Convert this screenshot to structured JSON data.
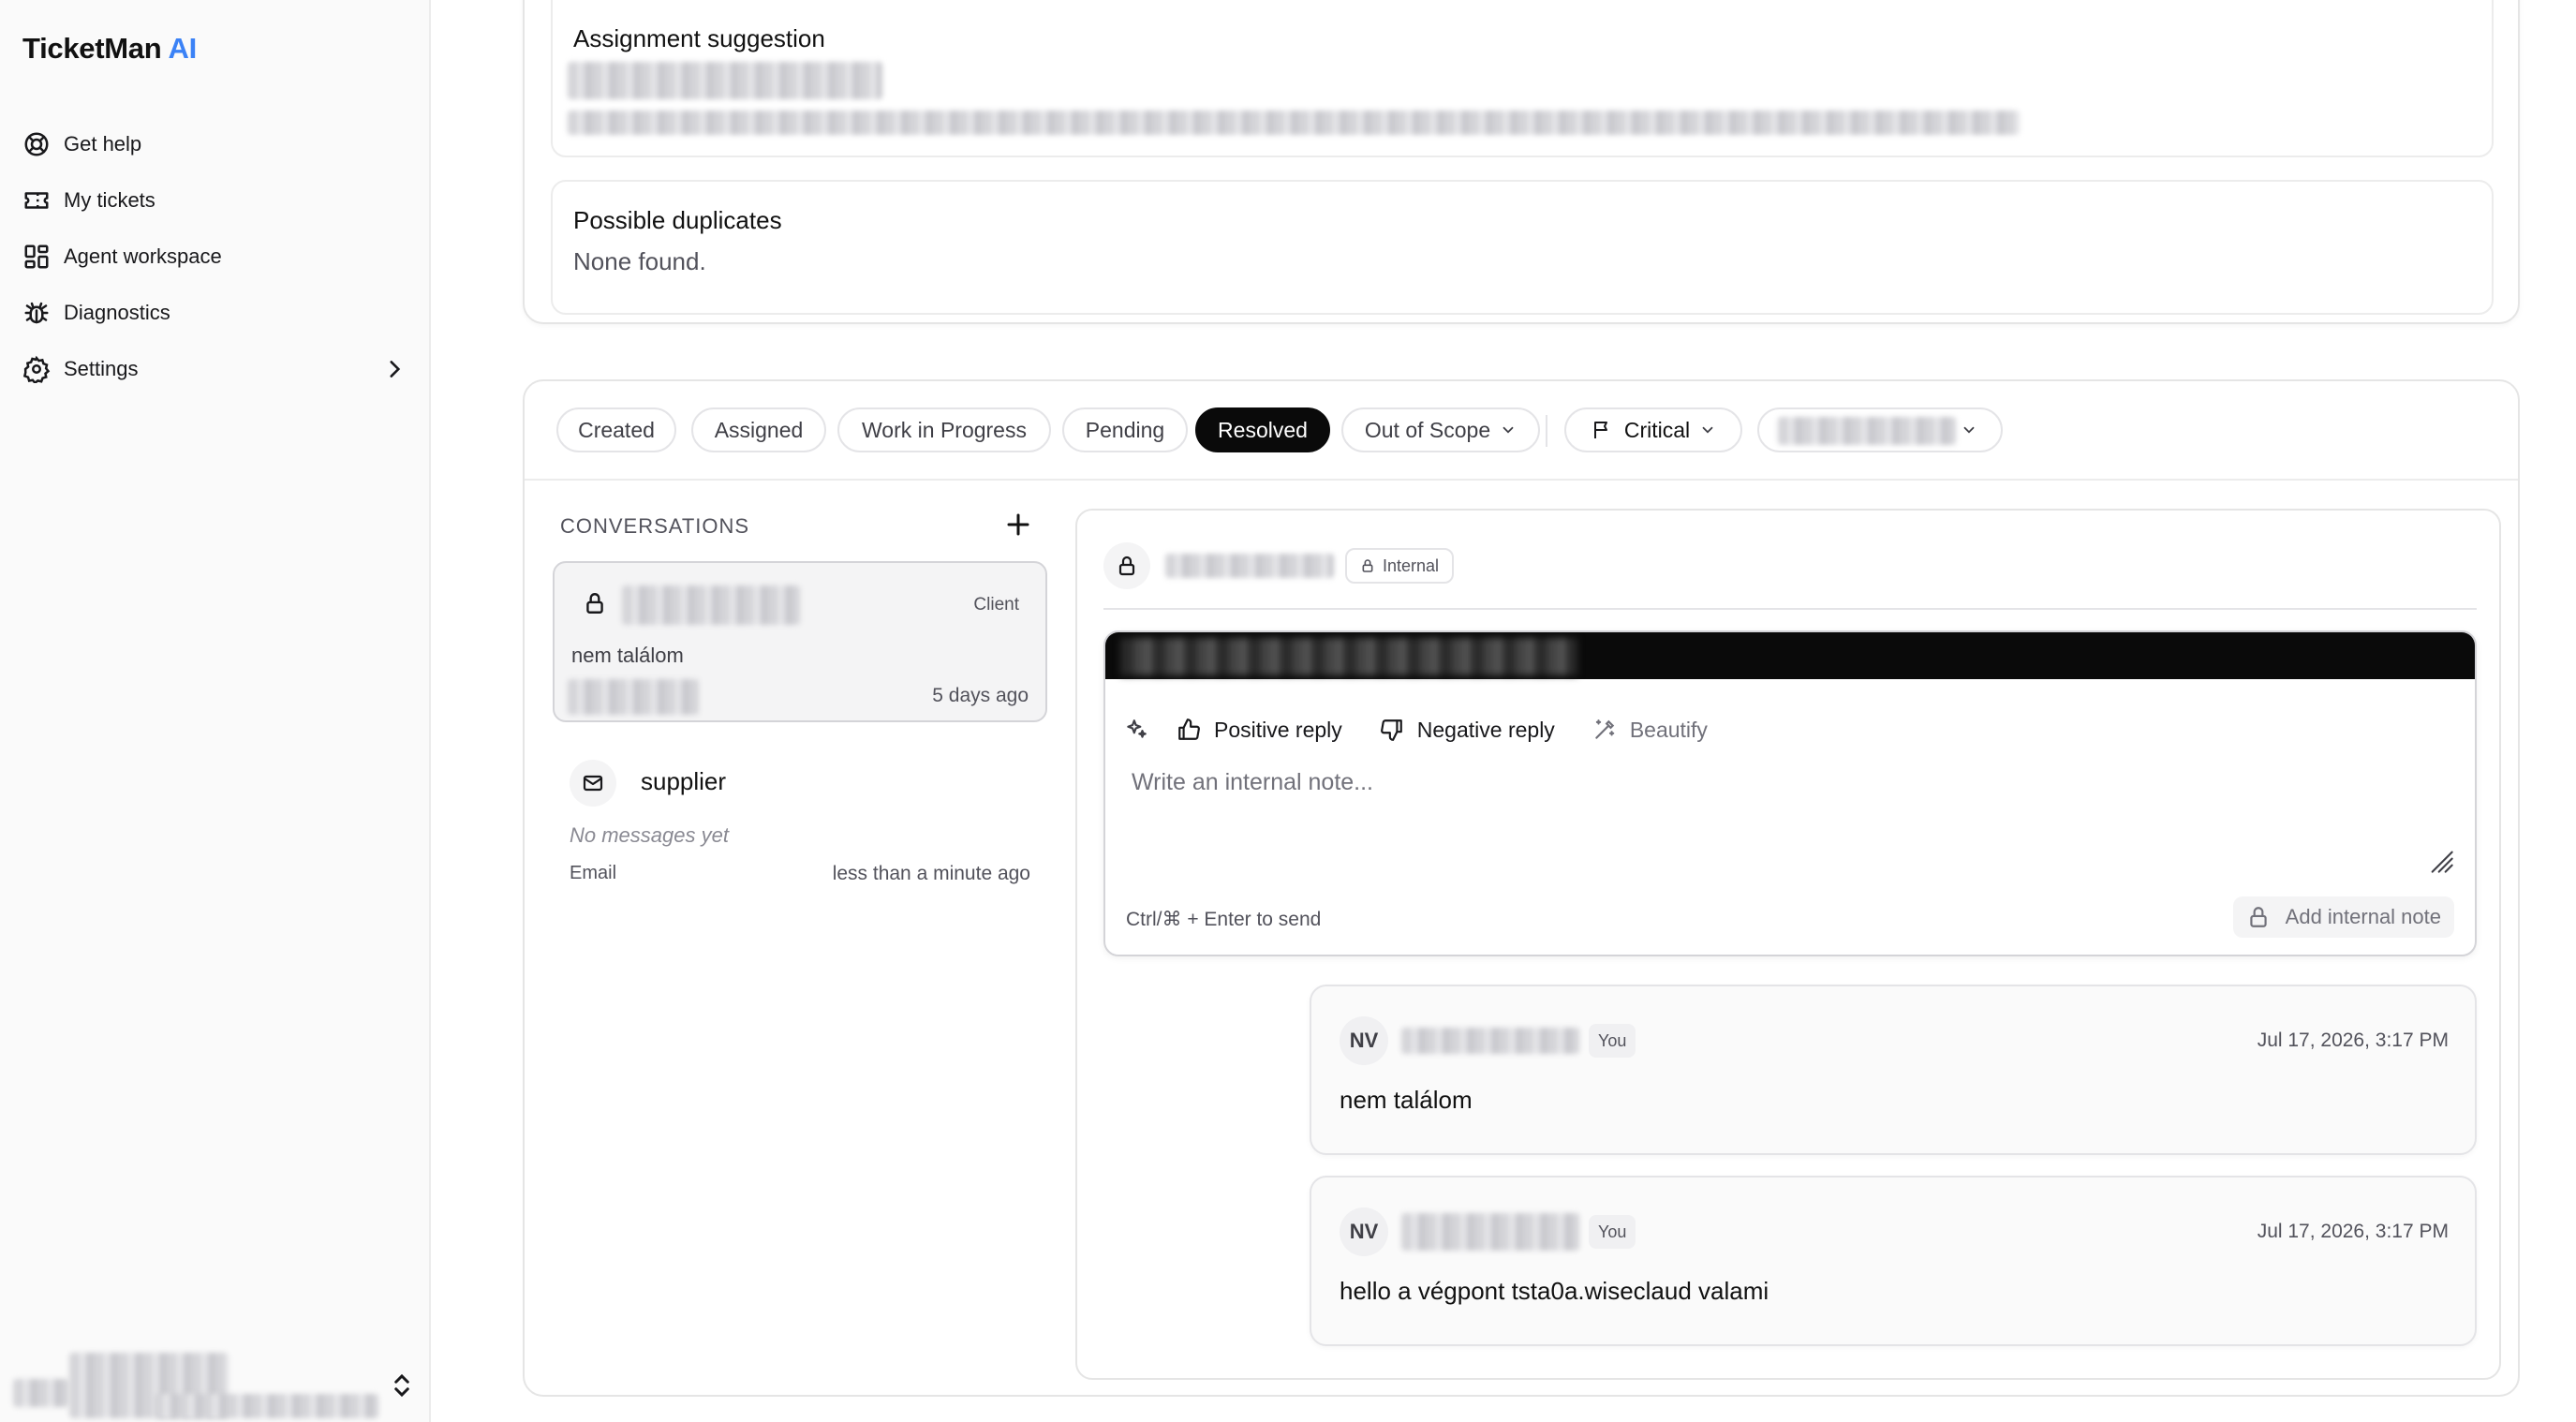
{
  "app": {
    "brand_main": "TicketMan",
    "brand_accent": "AI",
    "accent_color": "#3b82f6"
  },
  "sidebar": {
    "items": [
      {
        "label": "Get help",
        "icon": "lifebuoy-icon"
      },
      {
        "label": "My tickets",
        "icon": "ticket-icon"
      },
      {
        "label": "Agent workspace",
        "icon": "dashboard-icon"
      },
      {
        "label": "Diagnostics",
        "icon": "bug-icon"
      },
      {
        "label": "Settings",
        "icon": "gear-icon"
      }
    ]
  },
  "insights": {
    "assignment_title": "Assignment suggestion",
    "duplicates_title": "Possible duplicates",
    "duplicates_text": "None found."
  },
  "statuses": {
    "items": [
      "Created",
      "Assigned",
      "Work in Progress",
      "Pending",
      "Resolved",
      "Out of Scope"
    ],
    "active": "Resolved",
    "priority": "Critical"
  },
  "conversations": {
    "heading": "CONVERSATIONS",
    "selected": {
      "tag": "Client",
      "last_message": "nem találom",
      "time": "5 days ago"
    },
    "supplier": {
      "name": "supplier",
      "last_message": "No messages yet",
      "channel": "Email",
      "time": "less than a minute ago"
    }
  },
  "thread": {
    "badge": "Internal",
    "tools": {
      "positive": "Positive reply",
      "negative": "Negative reply",
      "beautify": "Beautify"
    },
    "placeholder": "Write an internal note...",
    "hint": "Ctrl/⌘ + Enter to send",
    "send_label": "Add internal note",
    "messages": [
      {
        "initials": "NV",
        "badge": "You",
        "time": "Jul 17, 2026, 3:17 PM",
        "text": "nem találom"
      },
      {
        "initials": "NV",
        "badge": "You",
        "time": "Jul 17, 2026, 3:17 PM",
        "text": "hello a végpont tsta0a.wiseclaud valami"
      }
    ]
  }
}
